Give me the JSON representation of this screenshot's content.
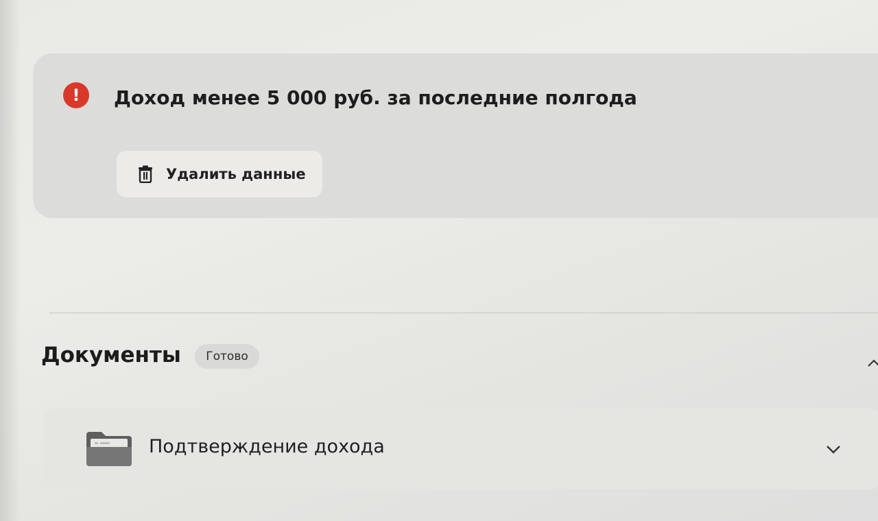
{
  "alert": {
    "icon": "exclamation-circle-icon",
    "icon_glyph": "!",
    "title": "Доход менее 5 000 руб. за последние полгода",
    "delete_button": {
      "icon": "trash-icon",
      "label": "Удалить данные"
    },
    "accent_color": "#d9392b"
  },
  "documents": {
    "title": "Документы",
    "status_badge": "Готово",
    "collapse_icon": "chevron-up-icon",
    "items": [
      {
        "icon": "folder-icon",
        "label": "Подтверждение дохода",
        "expand_icon": "chevron-down-icon"
      }
    ]
  }
}
